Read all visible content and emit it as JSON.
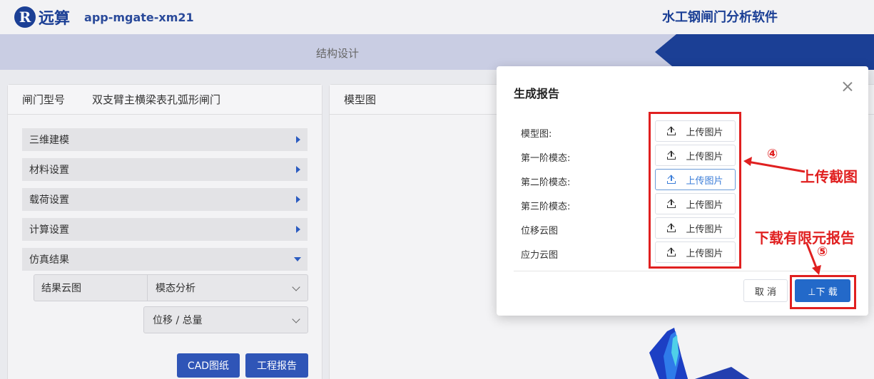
{
  "header": {
    "logo_mark": "R",
    "logo_text": "远算",
    "app_id": "app-mgate-xm21",
    "app_title": "水工钢闸门分析软件"
  },
  "tabbar": {
    "label": "结构设计"
  },
  "left_panel": {
    "gate_type_label": "闸门型号",
    "gate_type_value": "双支臂主横梁表孔弧形闸门",
    "sections": [
      {
        "label": "三维建模",
        "expanded": false
      },
      {
        "label": "材料设置",
        "expanded": false
      },
      {
        "label": "载荷设置",
        "expanded": false
      },
      {
        "label": "计算设置",
        "expanded": false
      },
      {
        "label": "仿真结果",
        "expanded": true
      }
    ],
    "result_cloud_label": "结果云图",
    "analysis_select": "模态分析",
    "component_select": "位移 / 总量",
    "cad_button": "CAD图纸",
    "report_button": "工程报告"
  },
  "right_panel": {
    "title": "模型图"
  },
  "dialog": {
    "title": "生成报告",
    "rows": [
      {
        "label": "模型图:",
        "button": "上传图片"
      },
      {
        "label": "第一阶模态:",
        "button": "上传图片"
      },
      {
        "label": "第二阶模态:",
        "button": "上传图片"
      },
      {
        "label": "第三阶模态:",
        "button": "上传图片"
      },
      {
        "label": "位移云图",
        "button": "上传图片"
      },
      {
        "label": "应力云图",
        "button": "上传图片"
      }
    ],
    "cancel": "取 消",
    "download": "⊥下 载"
  },
  "annotations": {
    "step4_num": "④",
    "step4_text": "上传截图",
    "step5_text": "下载有限元报告",
    "step5_num": "⑤"
  },
  "colors": {
    "brand": "#1b3f95",
    "primary": "#2369c9",
    "annotation": "#e02020"
  }
}
